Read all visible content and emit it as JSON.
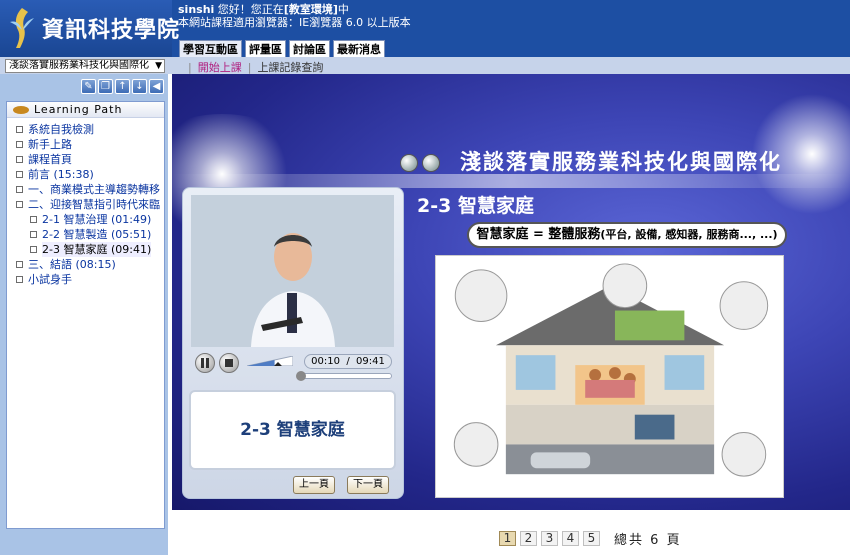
{
  "header": {
    "logo_text": "資訊科技學院",
    "greeting_user": "sinshi",
    "greeting_mid": " 您好！您正在",
    "greeting_env": "[教室環境]",
    "greeting_end": "中",
    "notice": "本網站課程適用瀏覽器：IE瀏覽器 6.0 以上版本",
    "tabs": [
      "學習互動區",
      "評量區",
      "討論區",
      "最新消息"
    ]
  },
  "subbar": {
    "course_select": "淺談落實服務業科技化與國際化",
    "link_start": "開始上課",
    "link_record": "上課記錄查詢"
  },
  "sidebar": {
    "icons": [
      "edit-icon",
      "copy-icon",
      "up-arrow-icon",
      "down-arrow-icon",
      "back-icon"
    ],
    "panel_title": "Learning Path",
    "items": [
      {
        "label": "系統自我檢測"
      },
      {
        "label": "新手上路"
      },
      {
        "label": "課程首頁"
      },
      {
        "label": "前言 (15:38)"
      },
      {
        "label": "一、商業模式主導趨勢轉移"
      },
      {
        "label": "二、迎接智慧指引時代來臨"
      },
      {
        "label": "2-1 智慧治理 (01:49)"
      },
      {
        "label": "2-2 智慧製造 (05:51)"
      },
      {
        "label": "2-3 智慧家庭 (09:41)"
      },
      {
        "label": "三、結語 (08:15)"
      },
      {
        "label": "小試身手"
      }
    ]
  },
  "slide": {
    "title": "淺談落實服務業科技化與國際化",
    "section": "2-3 智慧家庭",
    "formula_main": "智慧家庭 = 整體服務",
    "formula_detail": "(平台, 設備, 感知器, 服務商..., ...)"
  },
  "player": {
    "current_time": "00:10",
    "separator": "/",
    "total_time": "09:41",
    "progress": 0.02,
    "volume": 0.6,
    "caption": "2-3 智慧家庭",
    "prev_label": "上一頁",
    "next_label": "下一頁"
  },
  "pager": {
    "pages": [
      "1",
      "2",
      "3",
      "4",
      "5"
    ],
    "current": "1",
    "total_prefix": "總共",
    "total_count": "6",
    "total_suffix": "頁"
  }
}
